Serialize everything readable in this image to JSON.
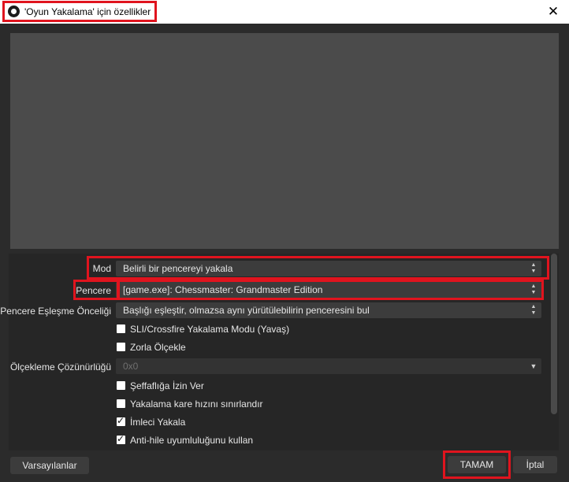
{
  "window": {
    "title": "'Oyun Yakalama' için özellikler",
    "close_icon": "close-icon"
  },
  "properties": {
    "mode": {
      "label": "Mod",
      "value": "Belirli bir pencereyi yakala"
    },
    "window_field": {
      "label": "Pencere",
      "value": "[game.exe]: Chessmaster: Grandmaster Edition"
    },
    "match_priority": {
      "label": "Pencere Eşleşme Önceliği",
      "value": "Başlığı eşleştir, olmazsa aynı yürütülebilirin penceresini bul"
    },
    "checkboxes_top": [
      {
        "label": "SLI/Crossfire Yakalama Modu (Yavaş)",
        "checked": false
      },
      {
        "label": "Zorla Ölçekle",
        "checked": false
      }
    ],
    "scale_resolution": {
      "label": "Ölçekleme Çözünürlüğü",
      "value": "0x0"
    },
    "checkboxes_bottom": [
      {
        "label": "Şeffaflığa İzin Ver",
        "checked": false
      },
      {
        "label": "Yakalama kare hızını sınırlandır",
        "checked": false
      },
      {
        "label": "İmleci Yakala",
        "checked": true
      },
      {
        "label": "Anti-hile uyumluluğunu kullan",
        "checked": true
      }
    ]
  },
  "buttons": {
    "defaults": "Varsayılanlar",
    "ok": "TAMAM",
    "cancel": "İptal"
  },
  "colors": {
    "highlight": "#e0141e",
    "background": "#2b2b2b",
    "preview": "#4b4b4b"
  }
}
